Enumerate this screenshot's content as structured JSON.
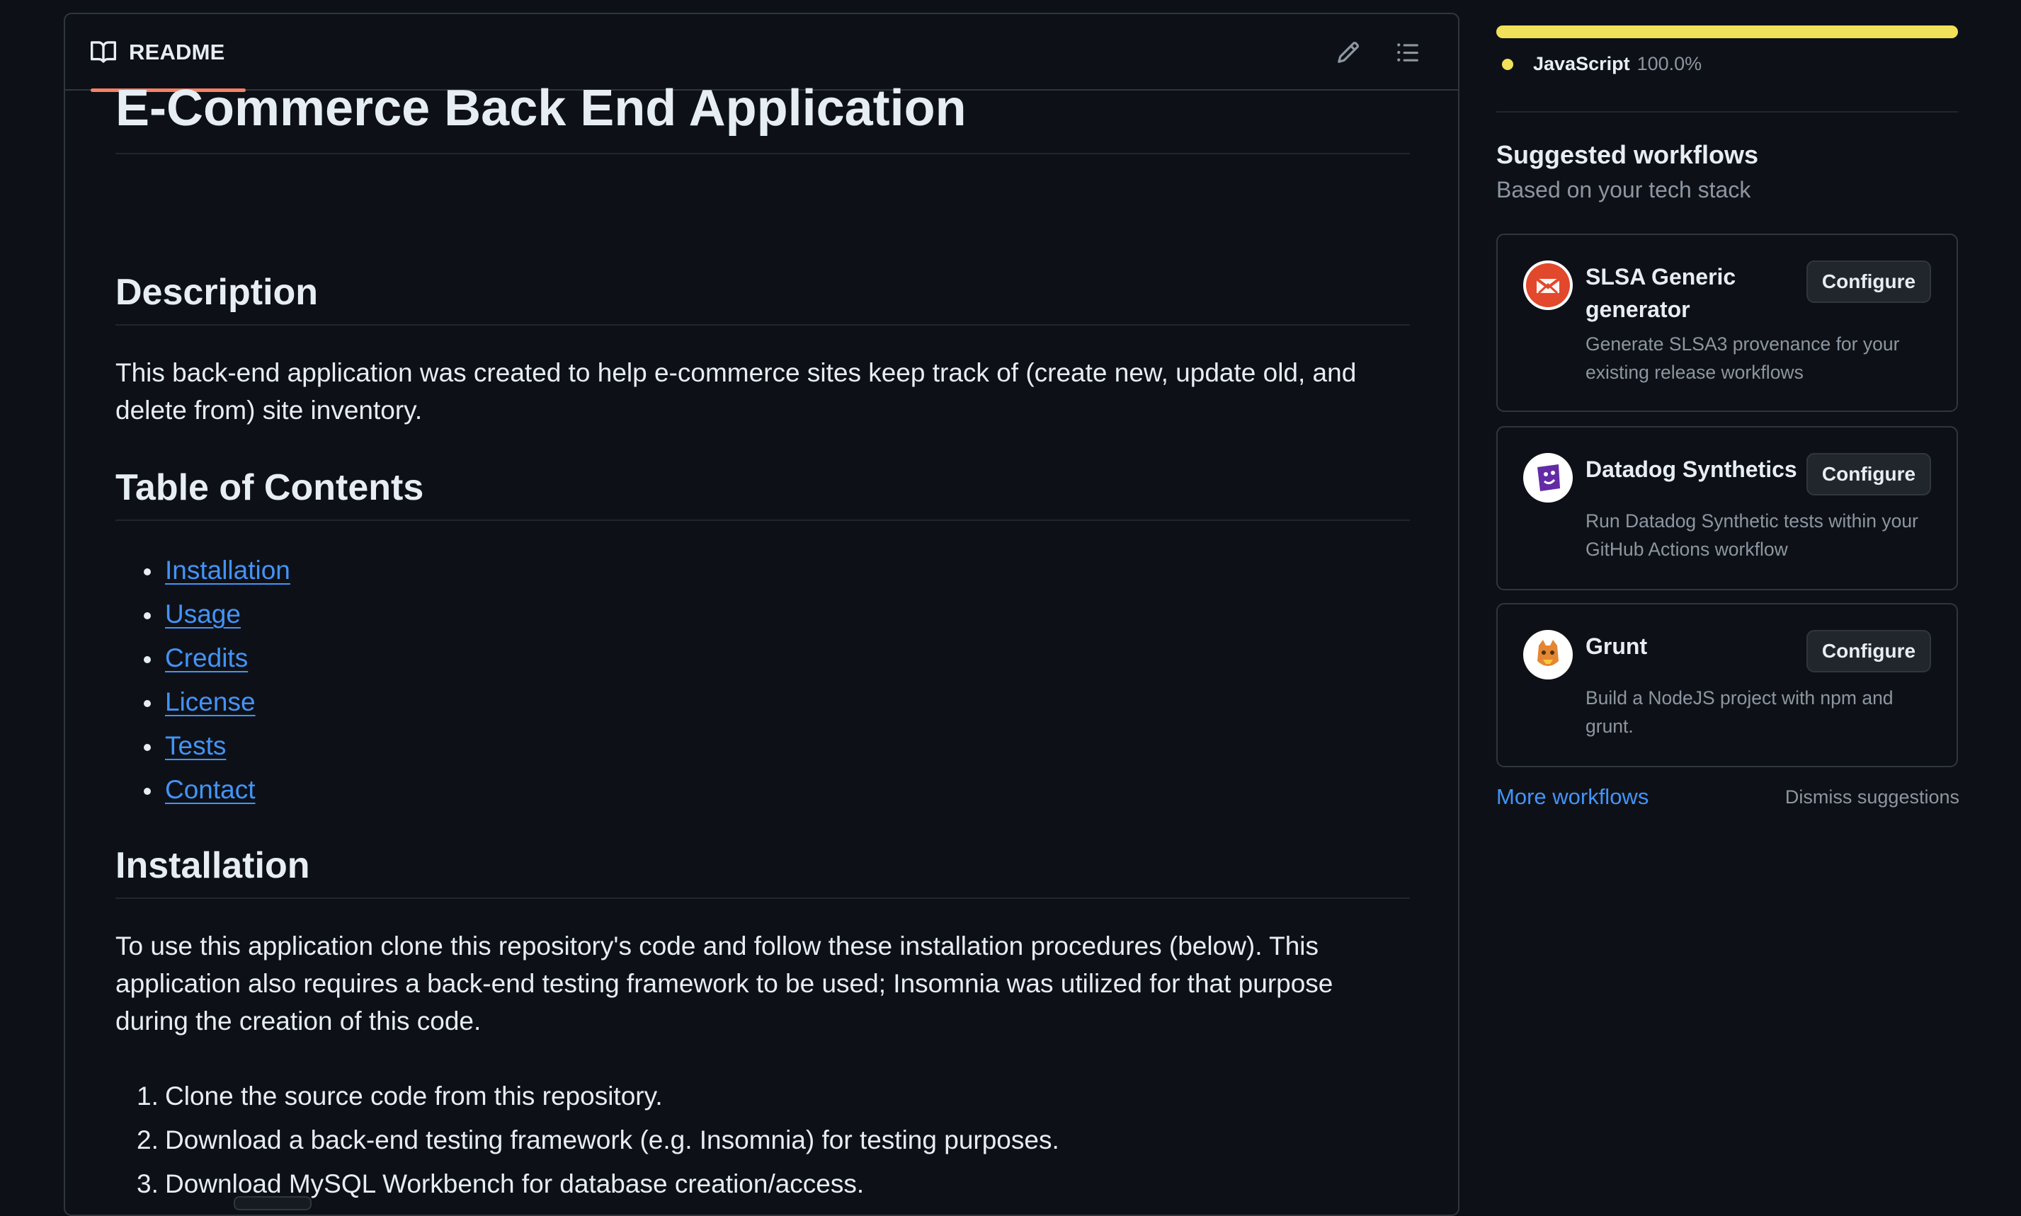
{
  "readme": {
    "tab_label": "README",
    "icons": {
      "book": "book-icon",
      "edit": "pencil-icon",
      "outline": "list-unordered-icon"
    },
    "title": "E-Commerce Back End Application",
    "sections": {
      "description": {
        "heading": "Description",
        "text": "This back-end application was created to help e-commerce sites keep track of (create new, update old, and delete from) site inventory."
      },
      "toc": {
        "heading": "Table of Contents",
        "items": [
          "Installation",
          "Usage",
          "Credits",
          "License",
          "Tests",
          "Contact"
        ]
      },
      "installation": {
        "heading": "Installation",
        "text": "To use this application clone this repository's code and follow these installation procedures (below). This application also requires a back-end testing framework to be used; Insomnia was utilized for that purpose during the creation of this code.",
        "steps": [
          {
            "num": "1.",
            "text": "Clone the source code from this repository."
          },
          {
            "num": "2.",
            "text": "Download a back-end testing framework (e.g. Insomnia) for testing purposes."
          },
          {
            "num": "3.",
            "text": "Download MySQL Workbench for database creation/access."
          }
        ]
      }
    }
  },
  "sidebar": {
    "languages": [
      {
        "name": "JavaScript",
        "percent": "100.0%",
        "color": "#f1e05a",
        "fraction": 1.0
      }
    ],
    "suggested": {
      "title": "Suggested workflows",
      "subtitle": "Based on your tech stack",
      "workflows": [
        {
          "name": "SLSA Generic generator",
          "description": "Generate SLSA3 provenance for your existing release workflows",
          "button": "Configure",
          "icon": "slsa-logo-icon"
        },
        {
          "name": "Datadog Synthetics",
          "description": "Run Datadog Synthetic tests within your GitHub Actions workflow",
          "button": "Configure",
          "icon": "datadog-logo-icon"
        },
        {
          "name": "Grunt",
          "description": "Build a NodeJS project with npm and grunt.",
          "button": "Configure",
          "icon": "grunt-logo-icon"
        }
      ],
      "more_link": "More workflows",
      "dismiss": "Dismiss suggestions"
    }
  },
  "colors": {
    "background": "#0d1117",
    "border": "#30363d",
    "text": "#e6edf3",
    "muted": "#8d96a0",
    "link": "#4493f8",
    "tab_accent": "#f78166",
    "javascript": "#f1e05a"
  }
}
